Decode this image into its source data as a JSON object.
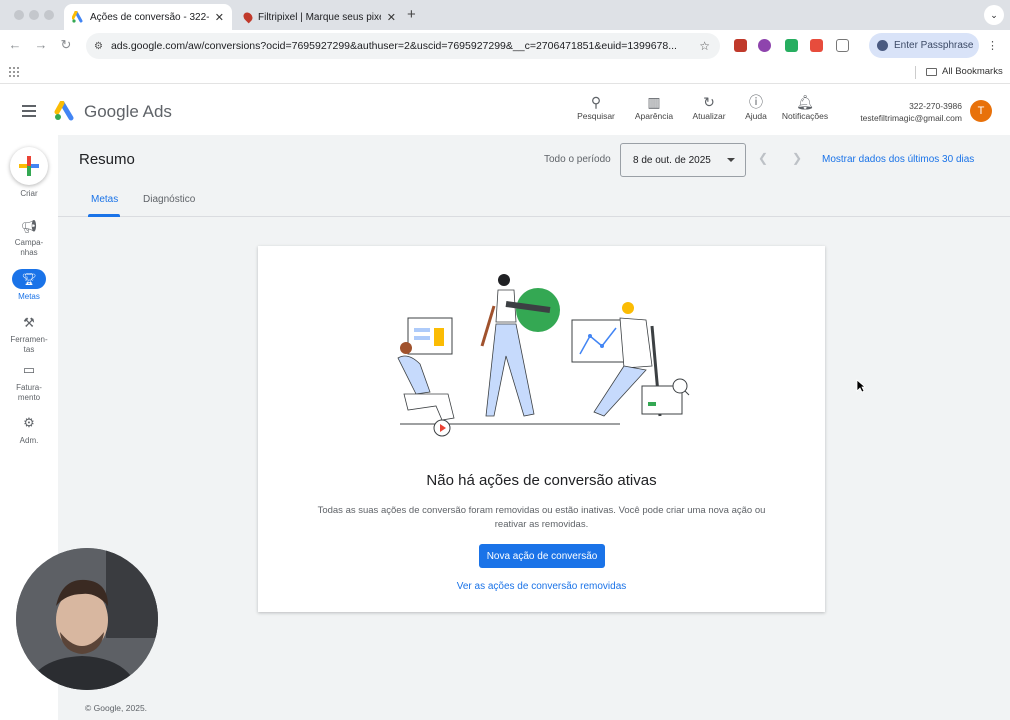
{
  "browser": {
    "tabs": [
      {
        "title": "Ações de conversão - 322-2",
        "active": true
      },
      {
        "title": "Filtripixel | Marque seus pixel",
        "active": false
      }
    ],
    "new_tab_label": "+",
    "url": "ads.google.com/aw/conversions?ocid=7695927299&authuser=2&uscid=7695927299&__c=2706471851&euid=1399678...",
    "passphrase_label": "Enter Passphrase",
    "bookmarks_label": "All Bookmarks"
  },
  "header": {
    "product": "Google Ads",
    "items": [
      {
        "label": "Pesquisar",
        "icon": "search-icon"
      },
      {
        "label": "Aparência",
        "icon": "appearance-icon"
      },
      {
        "label": "Atualizar",
        "icon": "refresh-icon"
      },
      {
        "label": "Ajuda",
        "icon": "help-icon"
      },
      {
        "label": "Notificações",
        "icon": "bell-icon"
      }
    ],
    "account_id": "322-270-3986",
    "account_email": "testefiltrimagic@gmail.com",
    "avatar_letter": "T"
  },
  "rail": {
    "create": "Criar",
    "campaigns": "Campa-\nnhas",
    "goals": "Metas",
    "tools": "Ferramen-\ntas",
    "billing": "Fatura-\nmento",
    "admin": "Adm."
  },
  "summary": {
    "title": "Resumo",
    "period_label": "Todo o período",
    "date": "8 de out. de 2025",
    "last_30": "Mostrar dados dos últimos 30 dias"
  },
  "tabs": [
    "Metas",
    "Diagnóstico"
  ],
  "empty_state": {
    "title": "Não há ações de conversão ativas",
    "description": "Todas as suas ações de conversão foram removidas ou estão inativas. Você pode criar uma nova ação ou reativar as removidas.",
    "primary_button": "Nova ação de conversão",
    "link": "Ver as ações de conversão removidas"
  },
  "footer": "© Google, 2025.",
  "colors": {
    "accent": "#1a73e8",
    "avatar": "#e8710a",
    "background": "#f1f3f4"
  }
}
